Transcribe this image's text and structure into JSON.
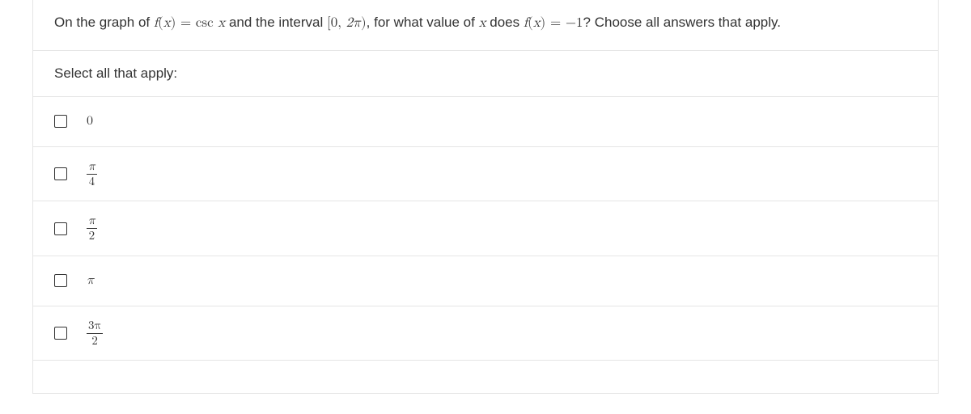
{
  "question": {
    "pre_fn": "On the graph of ",
    "fn_lhs_f": "f",
    "fn_lhs_paren_open": "(",
    "fn_lhs_x": "x",
    "fn_lhs_paren_close": ")",
    "eq1": " = ",
    "fn_rhs_csc": "csc",
    "fn_rhs_x": " x",
    "mid1": " and the interval ",
    "interval_open": "[",
    "interval_a": "0",
    "interval_sep": ", ",
    "interval_b": "2π",
    "interval_close": ")",
    "mid2": ", for what value of ",
    "var_x": "x",
    "mid3": " does ",
    "fn2_f": "f",
    "fn2_paren_open": "(",
    "fn2_x": "x",
    "fn2_paren_close": ")",
    "eq2": " = ",
    "val": "−1",
    "tail": "? Choose all answers that apply."
  },
  "prompt": "Select all that apply:",
  "options": [
    {
      "kind": "plain",
      "text": "0"
    },
    {
      "kind": "frac",
      "num": "π",
      "den": "4"
    },
    {
      "kind": "frac",
      "num": "π",
      "den": "2"
    },
    {
      "kind": "plain",
      "text": "π"
    },
    {
      "kind": "frac",
      "num": "3π",
      "den": "2"
    }
  ]
}
